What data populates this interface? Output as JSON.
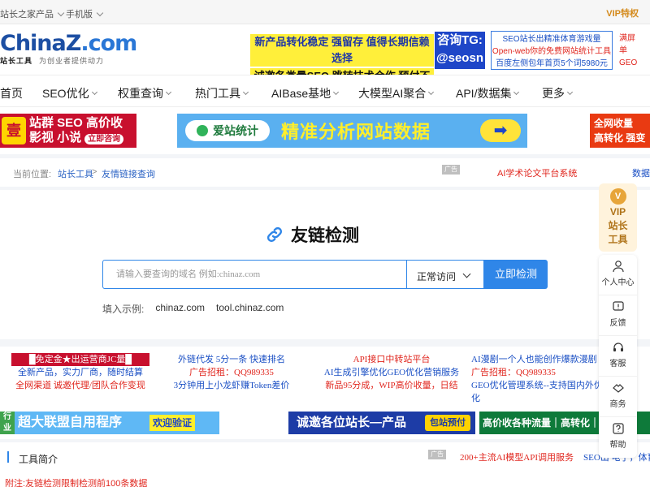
{
  "topbar": {
    "products": "站长之家产品",
    "mobile": "手机版",
    "vip": "VIP特权"
  },
  "header": {
    "logo_main": "ChinaZ",
    "logo_com": ".com",
    "logo_sub_bold": "站长工具",
    "logo_sub": "为创业者提供动力",
    "ad_line1": "新产品转化稳定 强留存 值得长期信赖选择",
    "ad_line2": "诚邀各类量SEO 跳转技术合作 预付不拖欠",
    "tg_line1": "咨询TG:",
    "tg_line2": "@seosn",
    "links": [
      "SEO站长出精准体育游戏量",
      "Open-web你的免费网站统计工具",
      "百度左侧包年首页5个词5980元"
    ],
    "right": [
      "满屏",
      "单",
      "GEO"
    ]
  },
  "nav": {
    "items": [
      {
        "label": "首页",
        "chev": false
      },
      {
        "label": "SEO优化",
        "chev": true
      },
      {
        "label": "权重查询",
        "chev": true
      },
      {
        "label": "热门工具",
        "chev": true
      },
      {
        "label": "AIBase基地",
        "chev": true
      },
      {
        "label": "大模型AI聚合",
        "chev": true
      },
      {
        "label": "API/数据集",
        "chev": true
      },
      {
        "label": "更多",
        "chev": true
      }
    ]
  },
  "banners": {
    "b1_tag": "壹",
    "b1_line1": "站群 SEO 高价收",
    "b1_line2": "影视 小说",
    "b1_consult": "立即咨询",
    "b2_brand": "爱站统计",
    "b2_text": "精准分析网站数据",
    "b2_arrow": "➡",
    "b3_line1": "全网收量",
    "b3_line2": "高转化 强变"
  },
  "breadcrumb": {
    "prefix": "当前位置:",
    "home": "站长工具",
    "sep": ">",
    "current": "友情链接查询",
    "ad": "广告",
    "ai_link": "AI学术论文平台系统",
    "right": "数据"
  },
  "tool": {
    "title": "友链检测",
    "placeholder": "请输入要查询的域名 例如:chinaz.com",
    "mode": "正常访问",
    "submit": "立即检测",
    "example_label": "填入示例:",
    "examples": [
      "chinaz.com",
      "tool.chinaz.com"
    ]
  },
  "ads": {
    "col1": [
      "█免定金★出运营商JC量█",
      "全新产品，实力厂商，随时结算",
      "全网渠道 诚邀代理/团队合作变现"
    ],
    "col2": [
      "外链代发 5分一条 快速排名",
      "广告招租：QQ989335",
      "3分钟用上小龙虾赚Token差价"
    ],
    "col3": [
      "API接口中转站平台",
      "AI生成引擎优化GEO优化营销服务",
      "新品95分成，WIP高价收量，日结"
    ],
    "col4": [
      "AI漫剧一个人也能创作爆款漫剧",
      "广告招租：QQ989335",
      "GEO优化管理系统--支持国内外优化"
    ]
  },
  "banners2": {
    "b1_tag": "行业",
    "b1_text": "超大联盟自用程序",
    "b1_cta": "欢迎验证",
    "b2_text": "诚邀各位站长—产品",
    "b2_cta": "包站预付",
    "b3_text": "高价收各种流量｜高转化｜高收益"
  },
  "bottom": {
    "title": "工具简介",
    "ad": "广告",
    "r1": "200+主流AI模型API调用服务",
    "r2": "SEO出 电子，体育",
    "note": "附注:友链检测限制检测前100条数据"
  },
  "dock": {
    "vip_line1": "VIP",
    "vip_line2": "站长",
    "vip_line3": "工具",
    "buttons": [
      "个人中心",
      "反馈",
      "客服",
      "商务",
      "帮助"
    ]
  }
}
